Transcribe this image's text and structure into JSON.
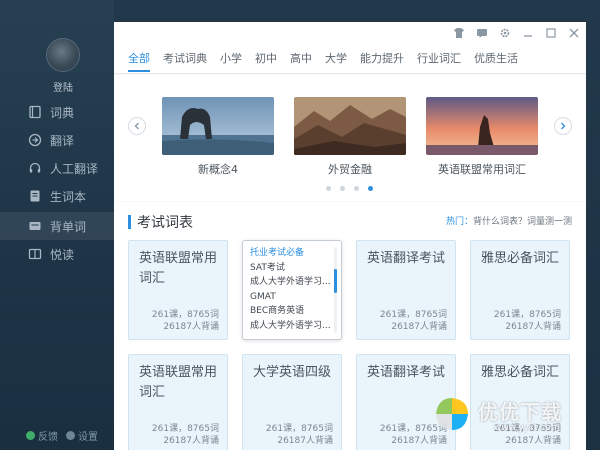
{
  "sidebar": {
    "avatar_name": "登陆",
    "items": [
      {
        "label": "词典",
        "icon": "book-icon"
      },
      {
        "label": "翻译",
        "icon": "translate-icon"
      },
      {
        "label": "人工翻译",
        "icon": "headset-icon"
      },
      {
        "label": "生词本",
        "icon": "notebook-icon"
      },
      {
        "label": "背单词",
        "icon": "card-icon"
      },
      {
        "label": "悦读",
        "icon": "reading-icon"
      }
    ],
    "bottom": [
      "反馈",
      "设置"
    ]
  },
  "tabs": [
    "全部",
    "考试词典",
    "小学",
    "初中",
    "高中",
    "大学",
    "能力提升",
    "行业词汇",
    "优质生活"
  ],
  "carousel": {
    "slides": [
      {
        "caption": "新概念4"
      },
      {
        "caption": "外贸金融"
      },
      {
        "caption": "英语联盟常用词汇"
      }
    ],
    "active_dot": 3
  },
  "section": {
    "title": "考试词表",
    "hot_label": "热门：",
    "hot_links": "背什么词表？词量测一测"
  },
  "cards_row1": [
    {
      "title": "英语联盟常用词汇",
      "meta1": "261课，8765词",
      "meta2": "26187人背诵"
    },
    {
      "title": "",
      "meta1": "",
      "meta2": ""
    },
    {
      "title": "英语翻译考试",
      "meta1": "261课，8765词",
      "meta2": "26187人背诵"
    },
    {
      "title": "雅思必备词汇",
      "meta1": "261课，8765词",
      "meta2": "26187人背诵"
    }
  ],
  "dropdown_options": [
    "托业考试必备",
    "SAT考试",
    "成人大学外语学习...",
    "GMAT",
    "BEC商务英语",
    "成人大学外语学习..."
  ],
  "cards_row2": [
    {
      "title": "英语联盟常用词汇",
      "meta1": "261课，8765词",
      "meta2": "26187人背诵"
    },
    {
      "title": "大学英语四级",
      "meta1": "261课，8765词",
      "meta2": "26187人背诵"
    },
    {
      "title": "英语翻译考试",
      "meta1": "261课，8765词",
      "meta2": "26187人背诵"
    },
    {
      "title": "雅思必备词汇",
      "meta1": "261课，8765词",
      "meta2": "26187人背诵"
    }
  ],
  "watermark": {
    "text": "优优下载",
    "url": "www.yyxt.com"
  },
  "colors": {
    "accent": "#2d8fe0",
    "card_bg": "#e9f4fb",
    "sidebar_bg": "#1e3446"
  }
}
